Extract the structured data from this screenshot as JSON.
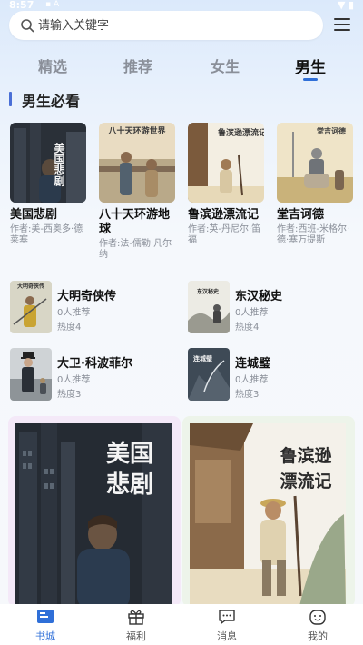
{
  "status": {
    "time": "8:57",
    "icons": "▪ A"
  },
  "search": {
    "placeholder": "请输入关键字"
  },
  "tabs": [
    {
      "label": "精选"
    },
    {
      "label": "推荐"
    },
    {
      "label": "女生"
    },
    {
      "label": "男生"
    }
  ],
  "section": {
    "title": "男生必看"
  },
  "top_books": [
    {
      "title": "美国悲剧",
      "author": "作者:美-西奥多·德莱塞",
      "cover_text": "美国悲剧"
    },
    {
      "title": "八十天环游地球",
      "author": "作者:法-儒勒·凡尔纳",
      "cover_text": "八十天环游世界"
    },
    {
      "title": "鲁滨逊漂流记",
      "author": "作者:英-丹尼尔·笛福",
      "cover_text": "鲁滨逊漂流记"
    },
    {
      "title": "堂吉诃德",
      "author": "作者:西班-米格尔·德·塞万提斯",
      "cover_text": "堂吉诃德"
    }
  ],
  "list_books": [
    {
      "title": "大明奇侠传",
      "rec": "0人推荐",
      "hot": "热度4",
      "cover_text": "大明奇侠传"
    },
    {
      "title": "东汉秘史",
      "rec": "0人推荐",
      "hot": "热度4",
      "cover_text": "东汉秘史"
    },
    {
      "title": "大卫·科波菲尔",
      "rec": "0人推荐",
      "hot": "热度3",
      "cover_text": ""
    },
    {
      "title": "连城璧",
      "rec": "0人推荐",
      "hot": "热度3",
      "cover_text": "连城璧"
    }
  ],
  "featured": [
    {
      "cover_text_1": "美国",
      "cover_text_2": "悲剧"
    },
    {
      "cover_text_1": "鲁滨逊",
      "cover_text_2": "漂流记"
    }
  ],
  "bottom_nav": [
    {
      "label": "书城"
    },
    {
      "label": "福利"
    },
    {
      "label": "消息"
    },
    {
      "label": "我的"
    }
  ],
  "colors": {
    "accent": "#2f6fd8",
    "section_bar": "#4a6fd6",
    "muted": "#8a8f99"
  }
}
